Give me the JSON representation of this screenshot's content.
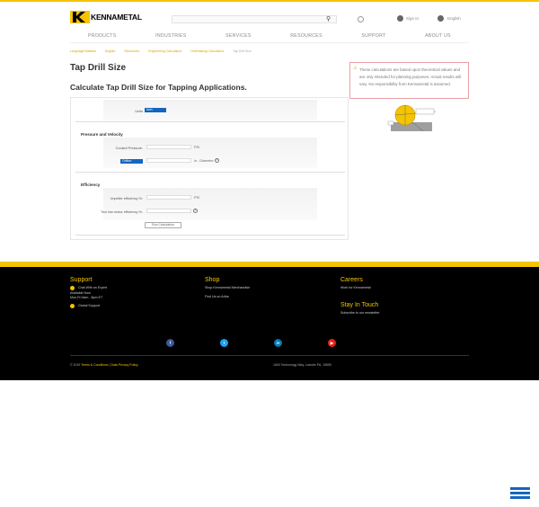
{
  "header": {
    "logo_text": "KENNAMETAL",
    "search_placeholder": "",
    "sign_in": "Sign In",
    "language": "English"
  },
  "nav": [
    "PRODUCTS",
    "INDUSTRIES",
    "SERVICES",
    "RESOURCES",
    "SUPPORT",
    "ABOUT US"
  ],
  "breadcrumb": [
    "Language Masters",
    "English",
    "Resources",
    "Engineering Calculators",
    "Holemaking Calculators",
    "Tap Drill Size"
  ],
  "page": {
    "title": "Tap Drill Size",
    "subtitle": "Calculate Tap Drill Size for Tapping Applications."
  },
  "form": {
    "units_label": "Units",
    "units_value": "Inch",
    "section_pressure": "Pressure and Velocity",
    "coolant_label": "Coolant Pressure:",
    "coolant_unit": "PSI",
    "orifice_value": "Orifice:",
    "orifice_unit": "in - Diameter",
    "section_efficiency": "Efficiency",
    "impeller_label": "Impeller efficiency %:",
    "motor_label": "Two line motor efficiency %:",
    "impeller_unit": "PSI",
    "calc_button": "Run Calculation"
  },
  "warning": {
    "text": "These calculations are based upon theoretical values and are only intended for planning purposes. Actual results will vary. No responsibility from Kennametal is assumed."
  },
  "footer": {
    "support_title": "Support",
    "chat": "Chat With an Expert",
    "available": "Available Now",
    "hours": "Mon-Fri 8am - 8pm ET",
    "global": "Global Support",
    "shop_title": "Shop",
    "shop_1": "Shop Kennametal Merchandise",
    "shop_2": "Find Us on Ariba",
    "careers_title": "Careers",
    "careers_1": "Work for Kennametal",
    "stay_title": "Stay In Touch",
    "stay_1": "Subscribe to our newsletter",
    "copyright_prefix": "© 2019",
    "terms": "Terms & Conditions",
    "sep": " | ",
    "privacy": "Data Privacy Policy",
    "address": "1600 Technology Way, Latrobe PA, 15650"
  },
  "colors": {
    "brand_yellow": "#f5c400",
    "select_blue": "#1565c0",
    "facebook": "#3b5998",
    "twitter": "#1da1f2",
    "linkedin": "#0077b5",
    "youtube": "#e62117"
  },
  "icons": [
    "search-icon",
    "flag-icon",
    "user-icon",
    "globe-icon",
    "warning-icon",
    "help-icon",
    "chat-icon",
    "globe-support-icon",
    "facebook-icon",
    "twitter-icon",
    "linkedin-icon",
    "youtube-icon",
    "menu-icon"
  ]
}
